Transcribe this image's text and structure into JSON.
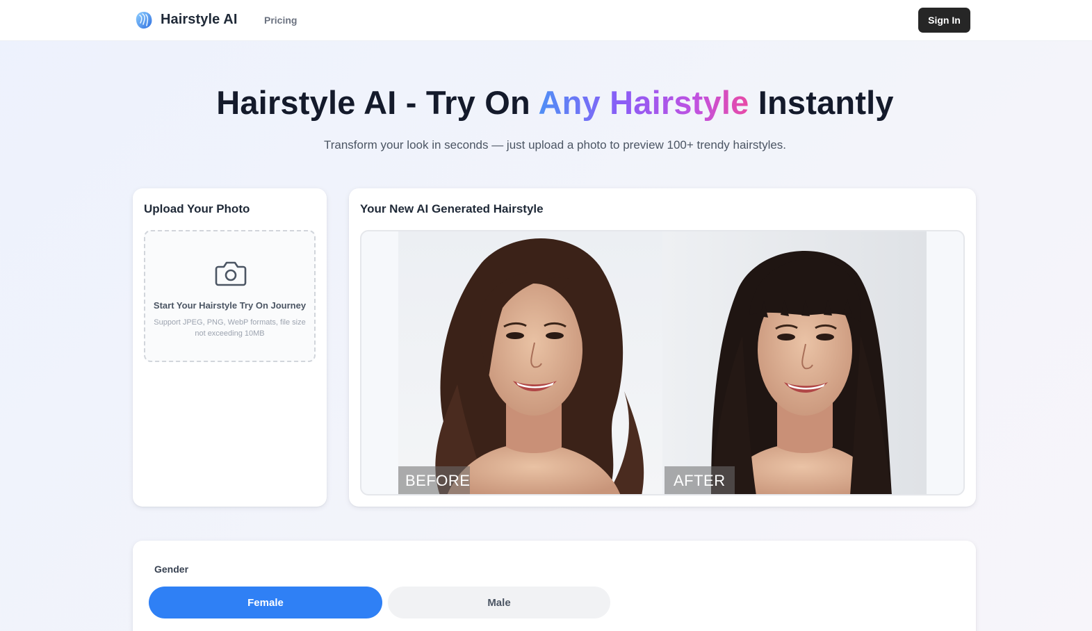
{
  "header": {
    "brand": "Hairstyle AI",
    "nav_pricing": "Pricing",
    "sign_in": "Sign In",
    "logo_icon": "hair-wave-logo-icon"
  },
  "hero": {
    "title_start": "Hairstyle AI - Try On ",
    "title_highlight": "Any Hairstyle",
    "title_end": " Instantly",
    "subtitle": "Transform your look in seconds — just upload a photo to preview 100+ trendy hairstyles."
  },
  "upload": {
    "title": "Upload Your Photo",
    "icon": "camera-icon",
    "prompt": "Start Your Hairstyle Try On Journey",
    "note": "Support JPEG, PNG, WebP formats, file size not exceeding 10MB"
  },
  "result": {
    "title": "Your New AI Generated Hairstyle",
    "before_label": "BEFORE",
    "after_label": "AFTER"
  },
  "options": {
    "gender_label": "Gender",
    "female": "Female",
    "male": "Male",
    "selected": "Female"
  },
  "colors": {
    "accent": "#2f80f5",
    "sign_in_bg": "#262626",
    "gradient": [
      "#4f8ff5",
      "#8b5cf6",
      "#c052e0",
      "#e84aa5"
    ]
  }
}
